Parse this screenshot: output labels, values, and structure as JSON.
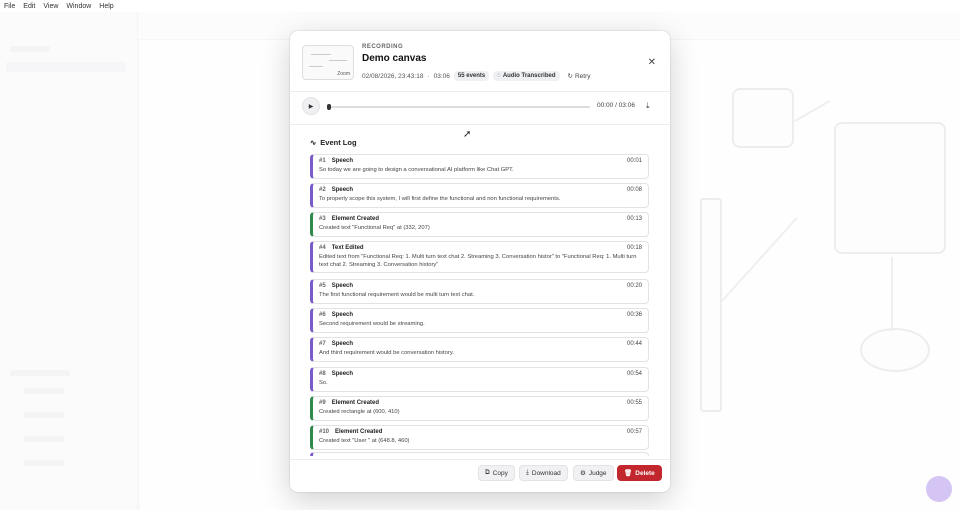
{
  "menubar": {
    "items": [
      "File",
      "Edit",
      "View",
      "Window",
      "Help"
    ]
  },
  "recording": {
    "label": "RECORDING",
    "title": "Demo canvas",
    "thumbnail_zoom": "Zoom",
    "datetime": "02/08/2026, 23:43:18",
    "separator": "·",
    "duration": "03:06",
    "events_badge": "55 events",
    "audio_badge": "Audio Transcribed",
    "retry_label": "Retry",
    "close_glyph": "✕"
  },
  "player": {
    "play_glyph": "▶",
    "time_display": "00:00 / 03:06",
    "progress": 0.0,
    "download_glyph": "⤓"
  },
  "event_log": {
    "title": "Event Log",
    "icon": "activity-icon",
    "events": [
      {
        "num": "#1",
        "type": "Speech",
        "time": "00:01",
        "desc": "So today we are going to design a conversational AI platform like Chat GPT.",
        "kind": "speech"
      },
      {
        "num": "#2",
        "type": "Speech",
        "time": "00:08",
        "desc": "To properly scope this system, I will first define the functional and non functional requirements.",
        "kind": "speech"
      },
      {
        "num": "#3",
        "type": "Element Created",
        "time": "00:13",
        "desc": "Created text \"Functional Req\" at (332, 207)",
        "kind": "element"
      },
      {
        "num": "#4",
        "type": "Text Edited",
        "time": "00:18",
        "desc": "Edited text from \"Functional Req: 1. Multi turn text chat 2. Streaming 3. Conversation histor\" to \"Functional Req: 1. Multi turn text chat 2. Streaming 3. Conversation history\"",
        "kind": "speech"
      },
      {
        "num": "#5",
        "type": "Speech",
        "time": "00:20",
        "desc": "The first functional requirement would be multi turn text chat.",
        "kind": "speech"
      },
      {
        "num": "#6",
        "type": "Speech",
        "time": "00:36",
        "desc": "Second requirement would be streaming.",
        "kind": "speech"
      },
      {
        "num": "#7",
        "type": "Speech",
        "time": "00:44",
        "desc": "And third requirement would be conversation history.",
        "kind": "speech"
      },
      {
        "num": "#8",
        "type": "Speech",
        "time": "00:54",
        "desc": "So.",
        "kind": "speech"
      },
      {
        "num": "#9",
        "type": "Element Created",
        "time": "00:55",
        "desc": "Created rectangle at (600, 410)",
        "kind": "element"
      },
      {
        "num": "#10",
        "type": "Element Created",
        "time": "00:57",
        "desc": "Created text \"User \" at (648.8, 460)",
        "kind": "element"
      }
    ]
  },
  "footer": {
    "copy_label": "Copy",
    "download_label": "Download",
    "judge_label": "Judge",
    "delete_label": "Delete"
  },
  "colors": {
    "speech_accent": "#7a5cc8",
    "element_accent": "#2f8a4c",
    "delete_bg": "#c1272d"
  }
}
